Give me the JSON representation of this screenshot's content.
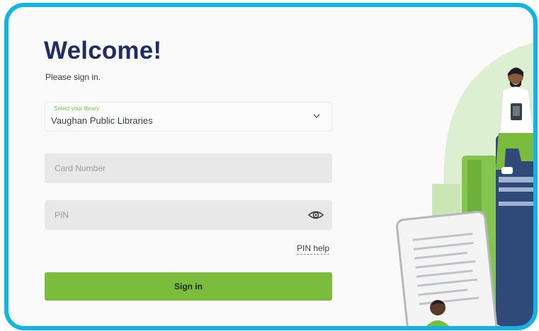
{
  "welcome": {
    "title": "Welcome!",
    "subtitle": "Please sign in."
  },
  "library_select": {
    "caption": "Select your library",
    "value": "Vaughan Public Libraries",
    "icon": "chevron-down-icon"
  },
  "card_number": {
    "value": "",
    "placeholder": "Card Number"
  },
  "pin": {
    "value": "",
    "placeholder": "PIN",
    "icon": "eye-icon"
  },
  "links": {
    "pin_help": "PIN help"
  },
  "actions": {
    "sign_in": "Sign in"
  },
  "colors": {
    "frame_border": "#12b4e6",
    "title": "#1f2d63",
    "accent_green": "#7cbc3c",
    "field_bg": "#e8e8e8",
    "book_navy": "#2f4a78"
  }
}
